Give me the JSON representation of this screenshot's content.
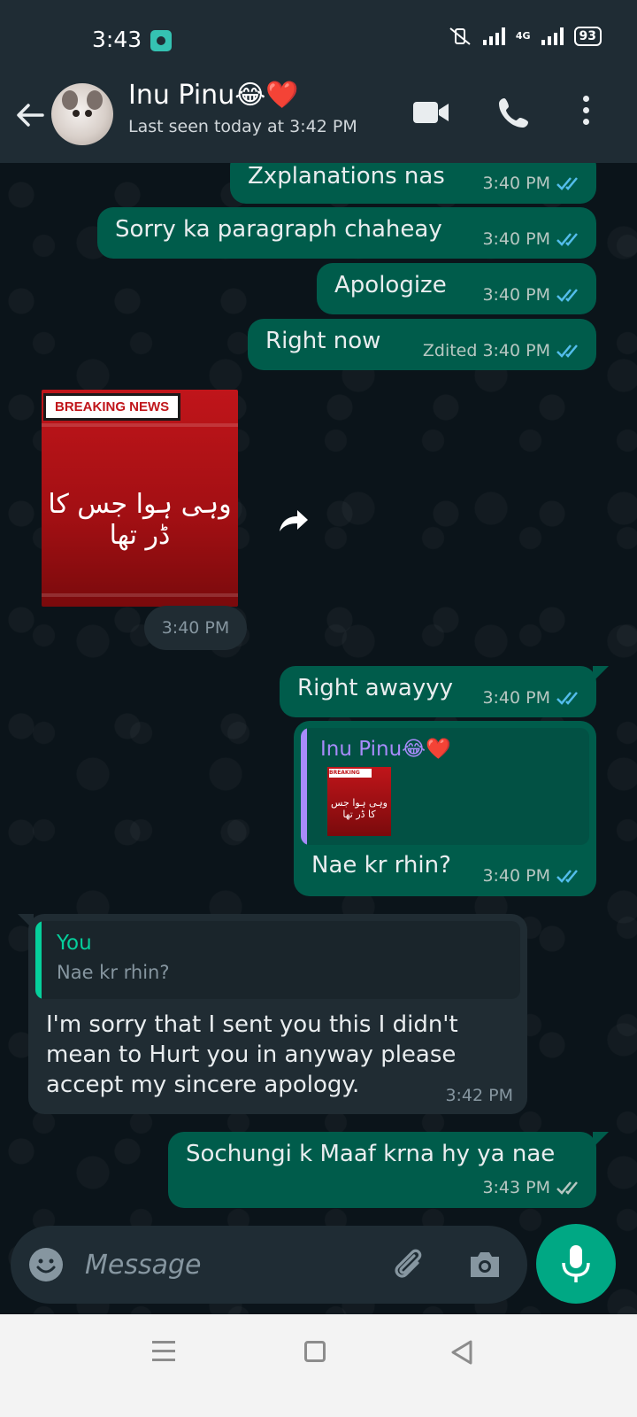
{
  "status_bar": {
    "time": "3:43",
    "network": "4G",
    "battery": "93"
  },
  "header": {
    "contact_name": "Inu Pinu😂❤️",
    "last_seen": "Last seen today at 3:42 PM"
  },
  "messages": [
    {
      "type": "text",
      "direction": "out",
      "text": "Zxplanations nas",
      "time": "3:40 PM",
      "status": "read"
    },
    {
      "type": "text",
      "direction": "out",
      "text": "Sorry ka paragraph chaheay",
      "time": "3:40 PM",
      "status": "read"
    },
    {
      "type": "text",
      "direction": "out",
      "text": "Apologize",
      "time": "3:40 PM",
      "status": "read"
    },
    {
      "type": "text",
      "direction": "out",
      "text": "Right now",
      "edited_label": "Zdited",
      "time": "3:40 PM",
      "status": "read"
    },
    {
      "type": "image",
      "direction": "in",
      "badge_text": "BREAKING NEWS",
      "caption": "وہی ہوا جس کا ڈر تھا",
      "time": "3:40 PM"
    },
    {
      "type": "text",
      "direction": "out",
      "text": "Right awayyy",
      "time": "3:40 PM",
      "status": "read"
    },
    {
      "type": "reply",
      "direction": "out",
      "quoted_name": "Inu Pinu😂❤️",
      "quoted_thumb_badge": "BREAKING NEWS",
      "quoted_thumb_caption": "وہی ہوا جس کا ڈر تھا",
      "text": "Nae kr rhin?",
      "time": "3:40 PM",
      "status": "read"
    },
    {
      "type": "reply",
      "direction": "in",
      "quoted_name": "You",
      "quoted_text": "Nae kr rhin?",
      "text_lines": [
        "I'm sorry that I sent you this I didn't",
        "mean to Hurt you in anyway please",
        "accept my sincere apology."
      ],
      "time": "3:42 PM"
    },
    {
      "type": "text",
      "direction": "out",
      "text": "Sochungi k Maaf krna hy ya nae",
      "time": "3:43 PM",
      "status": "delivered"
    }
  ],
  "input": {
    "placeholder": "Message"
  },
  "colors": {
    "outgoing_bubble": "#005c4b",
    "incoming_bubble": "#202c33",
    "read_ticks": "#53bdeb",
    "accent": "#00a884"
  },
  "icons": [
    "back-arrow-icon",
    "video-call-icon",
    "voice-call-icon",
    "more-options-icon",
    "forward-icon",
    "emoji-icon",
    "attach-icon",
    "camera-icon",
    "mic-icon"
  ]
}
